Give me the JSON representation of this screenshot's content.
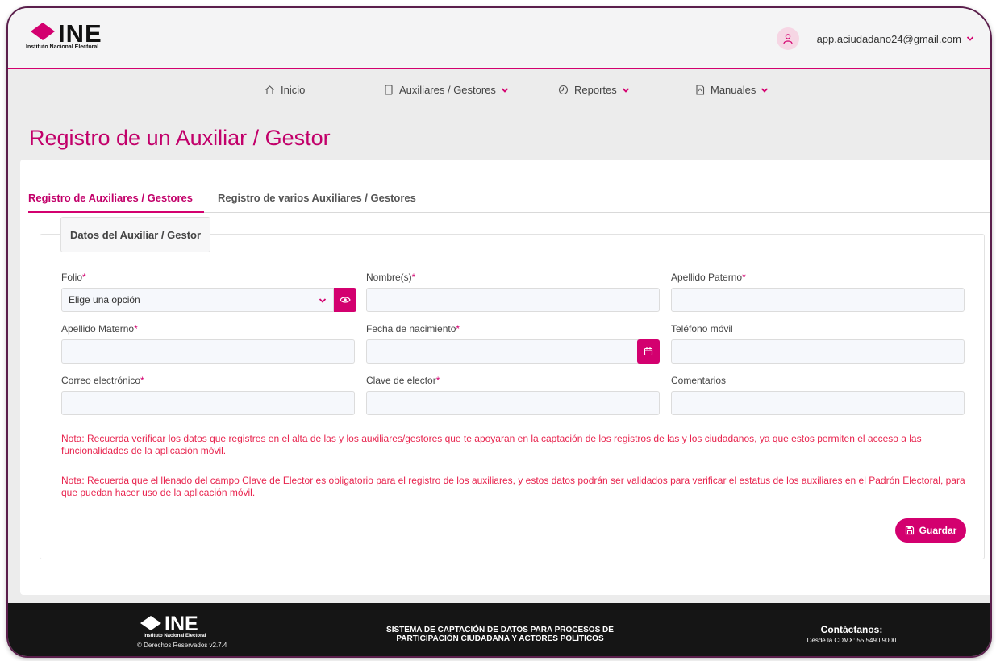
{
  "header": {
    "logo_text": "INE",
    "logo_subtitle": "Instituto Nacional Electoral",
    "user_email": "app.aciudadano24@gmail.com"
  },
  "nav": {
    "items": [
      {
        "label": "Inicio",
        "icon": "home-icon"
      },
      {
        "label": "Auxiliares / Gestores",
        "icon": "tablet-icon"
      },
      {
        "label": "Reportes",
        "icon": "clock-icon"
      },
      {
        "label": "Manuales",
        "icon": "pdf-icon"
      }
    ]
  },
  "page": {
    "title": "Registro de un Auxiliar / Gestor"
  },
  "tabs": [
    {
      "label": "Registro de Auxiliares / Gestores",
      "active": true
    },
    {
      "label": "Registro de varios Auxiliares / Gestores",
      "active": false
    }
  ],
  "form": {
    "legend": "Datos del Auxiliar / Gestor",
    "fields": {
      "folio": {
        "label": "Folio",
        "value": "Elige una opción"
      },
      "nombre": {
        "label": "Nombre(s)",
        "value": ""
      },
      "apellido_paterno": {
        "label": "Apellido Paterno",
        "value": ""
      },
      "apellido_materno": {
        "label": "Apellido Materno",
        "value": ""
      },
      "fecha_nacimiento": {
        "label": "Fecha de nacimiento",
        "value": ""
      },
      "telefono": {
        "label": "Teléfono móvil",
        "value": ""
      },
      "correo": {
        "label": "Correo electrónico",
        "value": ""
      },
      "clave_elector": {
        "label": "Clave de elector",
        "value": ""
      },
      "comentarios": {
        "label": "Comentarios",
        "value": ""
      }
    },
    "required_mark": "*",
    "note1": "Nota: Recuerda verificar los datos que registres en el alta de las y los auxiliares/gestores que te apoyaran en la captación de los registros de las y los ciudadanos, ya que estos permiten el acceso a las funcionalidades de la aplicación móvil.",
    "note2": "Nota: Recuerda que el llenado del campo Clave de Elector es obligatorio para el registro de los auxiliares, y estos datos podrán ser validados para verificar el estatus de los auxiliares en el Padrón Electoral, para que puedan hacer uso de la aplicación móvil.",
    "save_label": "Guardar"
  },
  "footer": {
    "logo_text": "INE",
    "logo_subtitle": "Instituto Nacional Electoral",
    "rights": "© Derechos Reservados v2.7.4",
    "system_line1": "SISTEMA DE CAPTACIÓN DE DATOS PARA PROCESOS DE",
    "system_line2": "PARTICIPACIÓN CIUDADANA Y ACTORES POLÍTICOS",
    "contact_title": "Contáctanos:",
    "contact_phone": "Desde la CDMX: 55 5490 9000"
  },
  "colors": {
    "accent": "#d3006f",
    "title": "#c2006a",
    "note": "#e8254f",
    "footer_bg": "#151515"
  }
}
